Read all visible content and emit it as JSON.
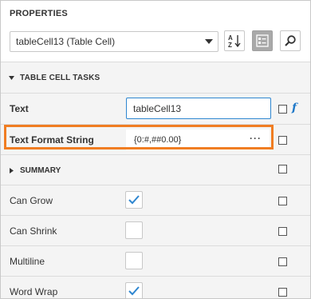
{
  "panel": {
    "title": "PROPERTIES",
    "component_selector": "tableCell13 (Table Cell)",
    "toolbar": {
      "sort_icon": "sort-alphabetical-icon",
      "categories_icon": "categories-icon",
      "search_icon": "search-icon"
    }
  },
  "tasks_section": {
    "label": "TABLE CELL TASKS"
  },
  "text_row": {
    "label": "Text",
    "value": "tableCell13"
  },
  "format_row": {
    "label": "Text Format String",
    "value": "{0:#,##0.00}",
    "ellipsis": "···"
  },
  "summary": {
    "label": "SUMMARY"
  },
  "props": [
    {
      "label": "Can Grow",
      "checked": true
    },
    {
      "label": "Can Shrink",
      "checked": false
    },
    {
      "label": "Multiline",
      "checked": false
    },
    {
      "label": "Word Wrap",
      "checked": true
    }
  ],
  "colors": {
    "accent": "#2e86d0",
    "highlight": "#f07d22",
    "row_bg": "#f4f4f4"
  }
}
